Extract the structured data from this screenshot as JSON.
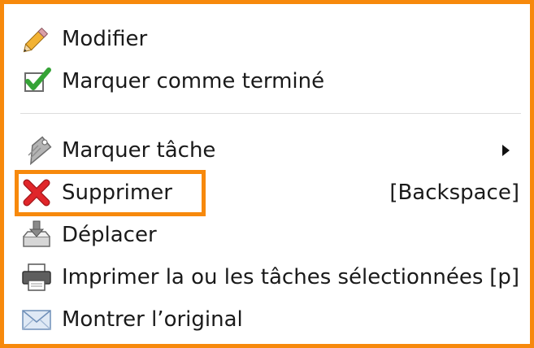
{
  "menu": {
    "items": [
      {
        "label": "Modifier",
        "icon": "pencil-icon"
      },
      {
        "label": "Marquer comme terminé",
        "icon": "checkbox-checked-icon"
      },
      {
        "label": "Marquer tâche",
        "icon": "tag-icon",
        "has_submenu": true
      },
      {
        "label": "Supprimer",
        "icon": "red-x-icon",
        "shortcut": "[Backspace]",
        "highlighted": true
      },
      {
        "label": "Déplacer",
        "icon": "move-tray-icon"
      },
      {
        "label": "Imprimer la ou les tâches sélectionnées",
        "icon": "printer-icon",
        "shortcut": "[p]"
      },
      {
        "label": "Montrer l’original",
        "icon": "envelope-icon"
      }
    ]
  },
  "colors": {
    "frame_border": "#f7890c",
    "highlight_border": "#f7890c",
    "delete_icon": "#e0262a",
    "check_icon": "#35a336"
  }
}
